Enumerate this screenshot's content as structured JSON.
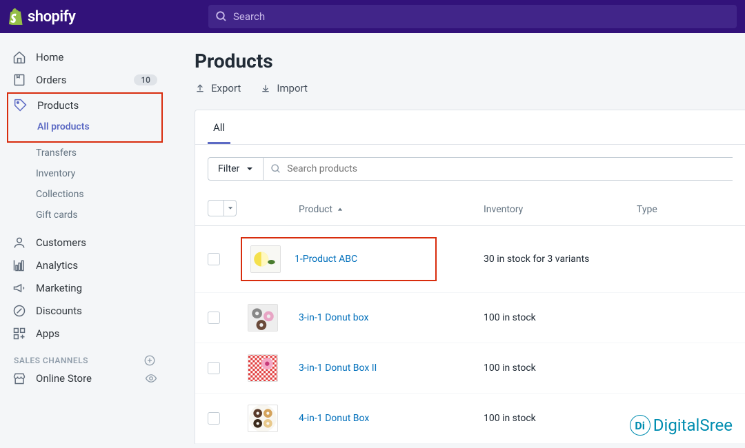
{
  "brand": "shopify",
  "search": {
    "placeholder": "Search"
  },
  "sidebar": {
    "items": [
      {
        "label": "Home"
      },
      {
        "label": "Orders",
        "badge": "10"
      },
      {
        "label": "Products"
      },
      {
        "label": "Customers"
      },
      {
        "label": "Analytics"
      },
      {
        "label": "Marketing"
      },
      {
        "label": "Discounts"
      },
      {
        "label": "Apps"
      }
    ],
    "products_sub": [
      {
        "label": "All products",
        "active": true
      },
      {
        "label": "Transfers"
      },
      {
        "label": "Inventory"
      },
      {
        "label": "Collections"
      },
      {
        "label": "Gift cards"
      }
    ],
    "section_title": "SALES CHANNELS",
    "channels": [
      {
        "label": "Online Store"
      }
    ]
  },
  "page": {
    "title": "Products",
    "export": "Export",
    "import": "Import",
    "tab_all": "All",
    "filter_label": "Filter",
    "search_placeholder": "Search products",
    "cols": {
      "product": "Product",
      "inventory": "Inventory",
      "type": "Type"
    },
    "rows": [
      {
        "name": "1-Product ABC",
        "inventory": "30 in stock for 3 variants",
        "highlighted": true,
        "thumb": "lemon"
      },
      {
        "name": "3-in-1 Donut box",
        "inventory": "100 in stock",
        "thumb": "donut-gray"
      },
      {
        "name": "3-in-1 Donut Box II",
        "inventory": "100 in stock",
        "thumb": "donut-red"
      },
      {
        "name": "4-in-1 Donut Box",
        "inventory": "100 in stock",
        "thumb": "donut-plate"
      }
    ]
  },
  "watermark": {
    "text": "DigitalSree",
    "d": "Di"
  }
}
